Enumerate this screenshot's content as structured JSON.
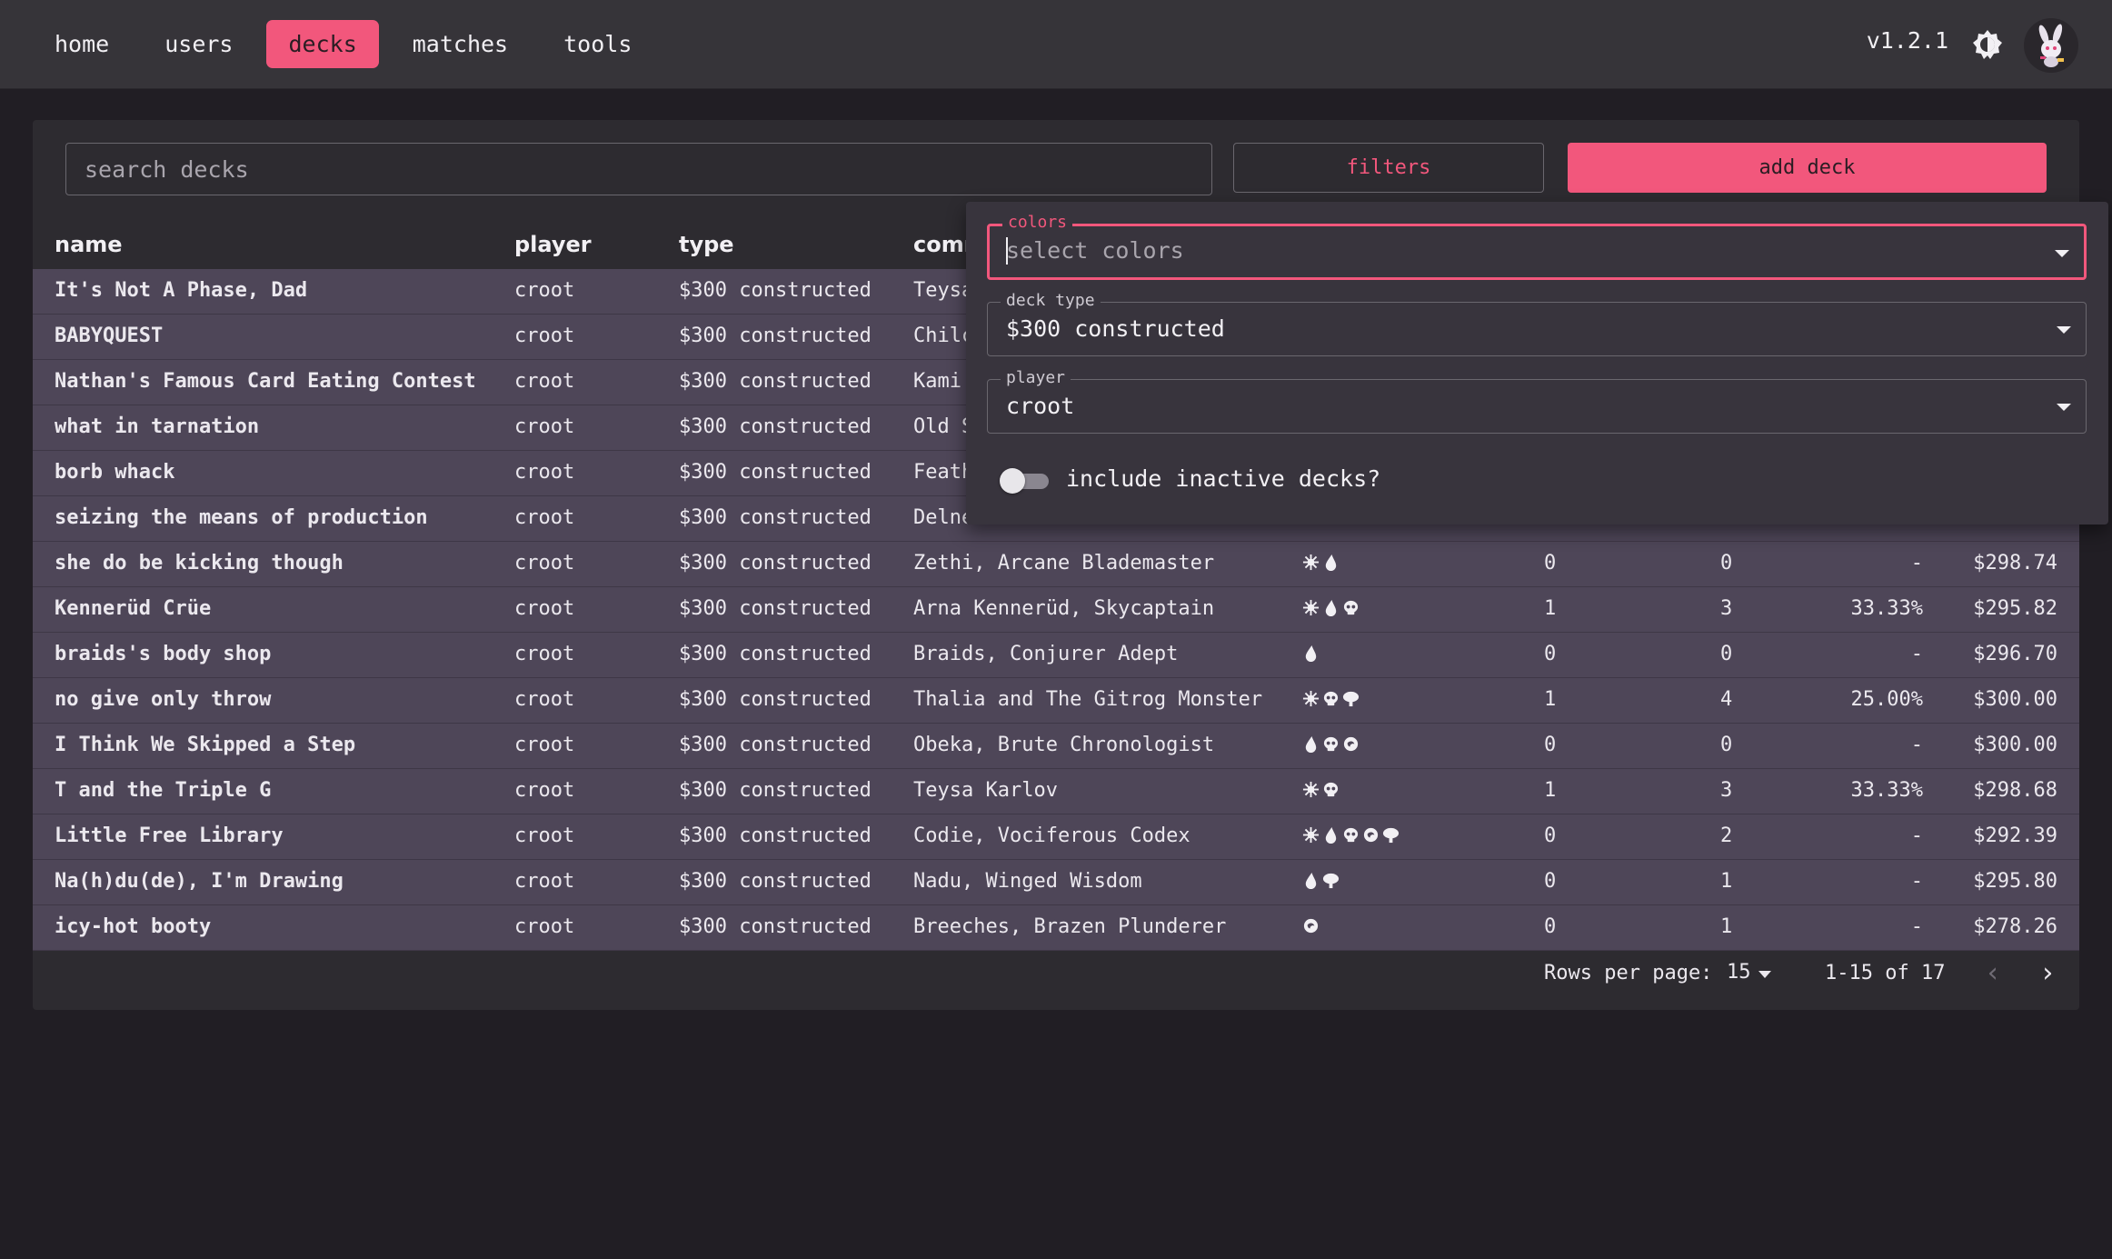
{
  "nav": {
    "items": [
      {
        "label": "home",
        "active": false
      },
      {
        "label": "users",
        "active": false
      },
      {
        "label": "decks",
        "active": true
      },
      {
        "label": "matches",
        "active": false
      },
      {
        "label": "tools",
        "active": false
      }
    ],
    "version": "v1.2.1",
    "theme_icon": "brightness-icon",
    "avatar_icon": "bunny-avatar"
  },
  "toolbar": {
    "search_placeholder": "search decks",
    "filters_label": "filters",
    "add_label": "add deck"
  },
  "table": {
    "headers": {
      "name": "name",
      "player": "player",
      "type": "type",
      "commander": "comm"
    },
    "rows": [
      {
        "name": "It's Not A Phase, Dad",
        "player": "croot",
        "type": "$300 constructed",
        "commander": "Teysa",
        "colors": [],
        "wins": "",
        "losses": "",
        "pct": "",
        "price": ""
      },
      {
        "name": "BABYQUEST",
        "player": "croot",
        "type": "$300 constructed",
        "commander": "Chilc",
        "colors": [],
        "wins": "",
        "losses": "",
        "pct": "",
        "price": ""
      },
      {
        "name": "Nathan's Famous Card Eating Contest",
        "player": "croot",
        "type": "$300 constructed",
        "commander": "Kami",
        "colors": [],
        "wins": "",
        "losses": "",
        "pct": "",
        "price": ""
      },
      {
        "name": "what in tarnation",
        "player": "croot",
        "type": "$300 constructed",
        "commander": "Old S",
        "colors": [],
        "wins": "",
        "losses": "",
        "pct": "",
        "price": ""
      },
      {
        "name": "borb whack",
        "player": "croot",
        "type": "$300 constructed",
        "commander": "Feath",
        "colors": [],
        "wins": "",
        "losses": "",
        "pct": "",
        "price": ""
      },
      {
        "name": "seizing the means of production",
        "player": "croot",
        "type": "$300 constructed",
        "commander": "Delne",
        "colors": [],
        "wins": "",
        "losses": "",
        "pct": "",
        "price": ""
      },
      {
        "name": "she do be kicking though",
        "player": "croot",
        "type": "$300 constructed",
        "commander": "Zethi, Arcane Blademaster",
        "colors": [
          "white",
          "blue"
        ],
        "wins": "0",
        "losses": "0",
        "pct": "-",
        "price": "$298.74"
      },
      {
        "name": "Kennerüd Crüe",
        "player": "croot",
        "type": "$300 constructed",
        "commander": "Arna Kennerüd, Skycaptain",
        "colors": [
          "white",
          "blue",
          "black"
        ],
        "wins": "1",
        "losses": "3",
        "pct": "33.33%",
        "price": "$295.82"
      },
      {
        "name": "braids's body shop",
        "player": "croot",
        "type": "$300 constructed",
        "commander": "Braids, Conjurer Adept",
        "colors": [
          "blue"
        ],
        "wins": "0",
        "losses": "0",
        "pct": "-",
        "price": "$296.70"
      },
      {
        "name": "no give only throw",
        "player": "croot",
        "type": "$300 constructed",
        "commander": "Thalia and The Gitrog Monster",
        "colors": [
          "white",
          "black",
          "green"
        ],
        "wins": "1",
        "losses": "4",
        "pct": "25.00%",
        "price": "$300.00"
      },
      {
        "name": "I Think We Skipped a Step",
        "player": "croot",
        "type": "$300 constructed",
        "commander": "Obeka, Brute Chronologist",
        "colors": [
          "blue",
          "black",
          "red"
        ],
        "wins": "0",
        "losses": "0",
        "pct": "-",
        "price": "$300.00"
      },
      {
        "name": "T and the Triple G",
        "player": "croot",
        "type": "$300 constructed",
        "commander": "Teysa Karlov",
        "colors": [
          "white",
          "black"
        ],
        "wins": "1",
        "losses": "3",
        "pct": "33.33%",
        "price": "$298.68"
      },
      {
        "name": "Little Free Library",
        "player": "croot",
        "type": "$300 constructed",
        "commander": "Codie, Vociferous Codex",
        "colors": [
          "white",
          "blue",
          "black",
          "red",
          "green"
        ],
        "wins": "0",
        "losses": "2",
        "pct": "-",
        "price": "$292.39"
      },
      {
        "name": "Na(h)du(de), I'm Drawing",
        "player": "croot",
        "type": "$300 constructed",
        "commander": "Nadu, Winged Wisdom",
        "colors": [
          "blue",
          "green"
        ],
        "wins": "0",
        "losses": "1",
        "pct": "-",
        "price": "$295.80"
      },
      {
        "name": "icy-hot booty",
        "player": "croot",
        "type": "$300 constructed",
        "commander": "Breeches, Brazen Plunderer",
        "colors": [
          "red"
        ],
        "wins": "0",
        "losses": "1",
        "pct": "-",
        "price": "$278.26"
      }
    ]
  },
  "pagination": {
    "rows_per_page_label": "Rows per page:",
    "rows_per_page": "15",
    "range": "1-15 of 17",
    "prev": "‹",
    "next": "›"
  },
  "filters_popup": {
    "colors": {
      "label": "colors",
      "placeholder": "select colors",
      "value": ""
    },
    "deck_type": {
      "label": "deck type",
      "value": "$300 constructed"
    },
    "player": {
      "label": "player",
      "value": "croot"
    },
    "inactive_toggle": {
      "label": "include inactive decks?",
      "on": false
    }
  },
  "colors": {
    "accent": "#f2577c",
    "row_bg": "#4e4658",
    "popup_bg": "#38343d"
  }
}
